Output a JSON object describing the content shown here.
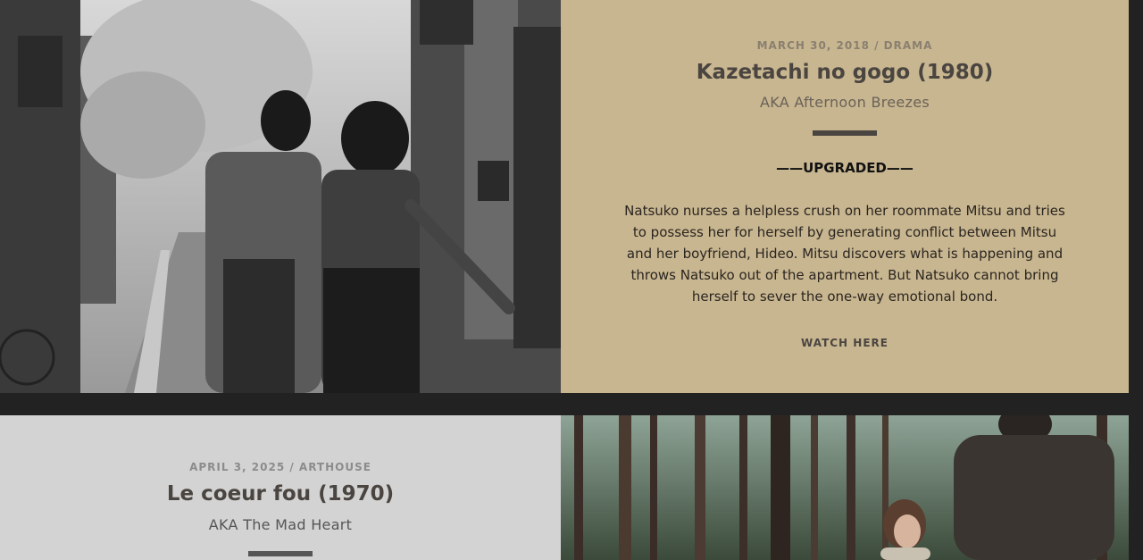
{
  "posts": [
    {
      "meta": "MARCH 30, 2018 / DRAMA",
      "title": "Kazetachi no gogo (1980)",
      "aka": "AKA Afternoon Breezes",
      "tag": "——UPGRADED——",
      "description": "Natsuko nurses a helpless crush on her roommate Mitsu and tries to possess her for herself by generating conflict between Mitsu and her boyfriend, Hideo. Mitsu discovers what is happening and throws Natsuko out of the apartment. But Natsuko cannot bring herself to sever the one-way emotional bond.",
      "cta": "WATCH HERE",
      "image_alt": "black-and-white still of two young women walking arm in arm down a narrow street",
      "panel_color": "#c8b690"
    },
    {
      "meta": "APRIL 3, 2025 / ARTHOUSE",
      "title": "Le coeur fou (1970)",
      "aka": "AKA The Mad Heart",
      "image_alt": "color still of a woman and a man in a pine forest",
      "panel_color": "#d3d3d3"
    }
  ]
}
